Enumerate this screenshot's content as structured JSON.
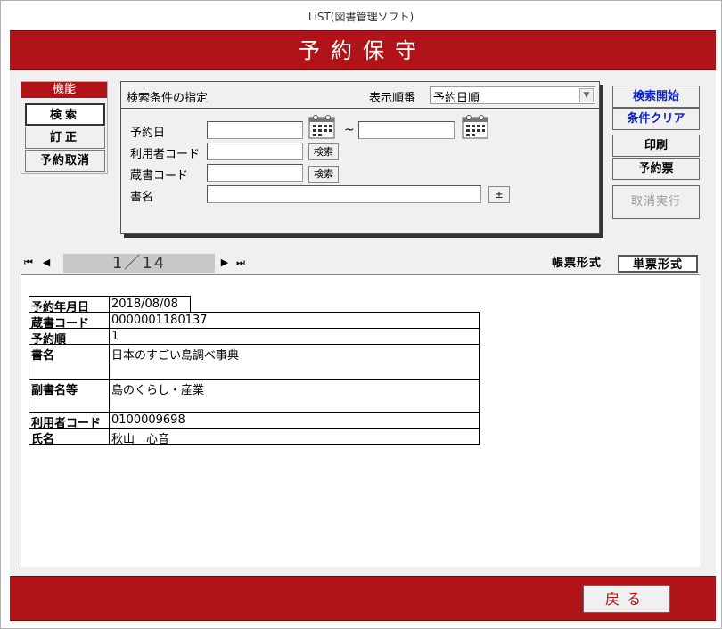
{
  "window": {
    "title": "LiST(図書管理ソフト)"
  },
  "header": {
    "title": "予約保守"
  },
  "function_panel": {
    "label": "機能",
    "buttons": [
      {
        "label": "検索",
        "active": true
      },
      {
        "label": "訂正",
        "active": false
      },
      {
        "label": "予約取消",
        "active": false
      }
    ]
  },
  "search": {
    "title": "検索条件の指定",
    "order_label": "表示順番",
    "order_value": "予約日順",
    "fields": {
      "reserve_date_label": "予約日",
      "range_sep": "~",
      "user_code_label": "利用者コード",
      "book_code_label": "蔵書コード",
      "title_label": "書名",
      "search_btn": "検索",
      "plus_btn": "±"
    },
    "values": {
      "date_from": "",
      "date_to": "",
      "user_code": "",
      "book_code": "",
      "title": ""
    }
  },
  "actions": {
    "search_start": "検索開始",
    "clear": "条件クリア",
    "print": "印刷",
    "reserve_slip": "予約票",
    "cancel_exec": "取消実行"
  },
  "navigation": {
    "first": "⏮",
    "prev": "◀",
    "next": "▶",
    "last": "⏭",
    "counter": "1／14"
  },
  "view_modes": {
    "list": "帳票形式",
    "single": "単票形式",
    "active": "single"
  },
  "record": {
    "rows": [
      {
        "label": "予約年月日",
        "value": "2018/08/08"
      },
      {
        "label": "蔵書コード",
        "value": "0000001180137"
      },
      {
        "label": "予約順",
        "value": "1"
      },
      {
        "label": "書名",
        "value": "日本のすごい島調べ事典"
      },
      {
        "label": "副書名等",
        "value": "島のくらし・産業"
      },
      {
        "label": "利用者コード",
        "value": "0100009698"
      },
      {
        "label": "氏名",
        "value": "秋山　心音"
      }
    ]
  },
  "footer": {
    "back": "戻る"
  },
  "colors": {
    "brand_red": "#b01418",
    "link_blue": "#0a23d6",
    "disabled_gray": "#9a9a9a"
  },
  "icons": [
    "calendar-icon",
    "first-record-icon",
    "prev-record-icon",
    "next-record-icon",
    "last-record-icon",
    "dropdown-arrow-icon"
  ]
}
